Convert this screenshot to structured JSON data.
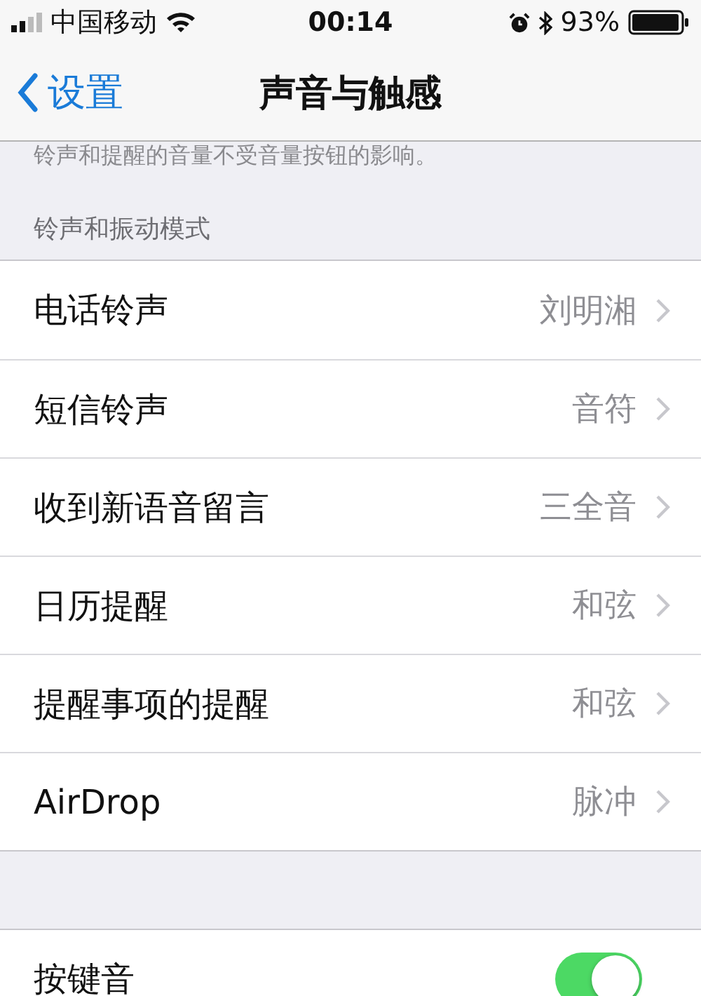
{
  "status_bar": {
    "carrier": "中国移动",
    "time": "00:14",
    "battery": "93%"
  },
  "nav": {
    "back": "设置",
    "title": "声音与触感"
  },
  "footnote": "铃声和提醒的音量不受音量按钮的影响。",
  "section_header": "铃声和振动模式",
  "sounds": [
    {
      "label": "电话铃声",
      "value": "刘明湘"
    },
    {
      "label": "短信铃声",
      "value": "音符"
    },
    {
      "label": "收到新语音留言",
      "value": "三全音"
    },
    {
      "label": "日历提醒",
      "value": "和弦"
    },
    {
      "label": "提醒事项的提醒",
      "value": "和弦"
    },
    {
      "label": "AirDrop",
      "value": "脉冲"
    }
  ],
  "toggles": [
    {
      "label": "按键音",
      "on": true
    }
  ]
}
